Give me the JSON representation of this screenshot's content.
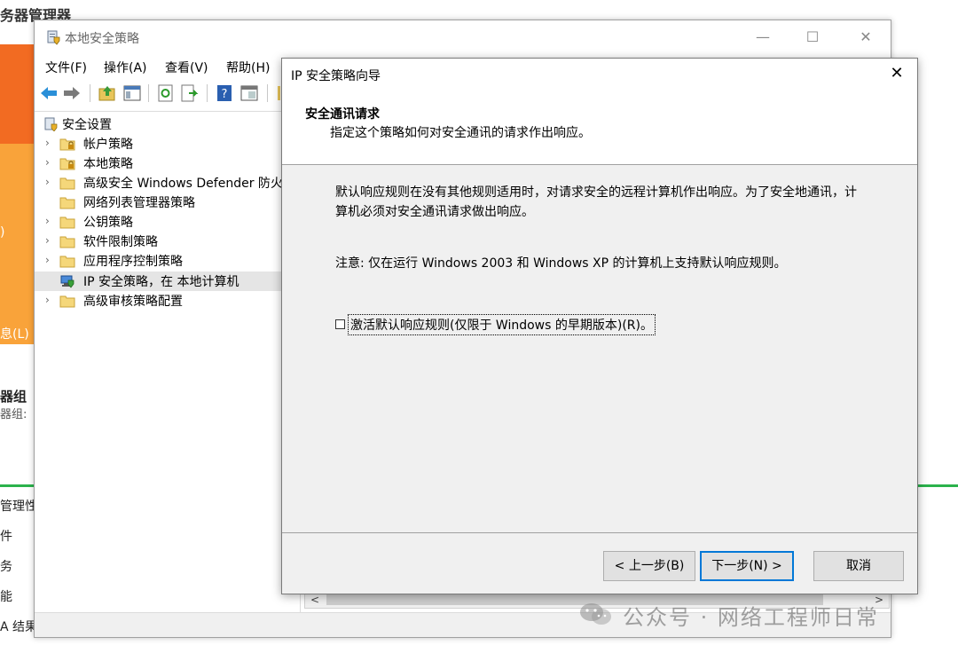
{
  "background": {
    "title_partial": "务器管理器",
    "left_fragments": [
      {
        "text": ")"
      },
      {
        "text": "息(L)"
      },
      {
        "text": "器组"
      },
      {
        "text": "器组:"
      },
      {
        "text": "管理性"
      },
      {
        "text": "件"
      },
      {
        "text": "务"
      },
      {
        "text": "能"
      },
      {
        "text": "A 结果"
      }
    ],
    "accent_color": "#f26b22",
    "accent_color_light": "#f9a33a",
    "green_line_color": "#2bb24c"
  },
  "lsp_window": {
    "title": "本地安全策略",
    "controls": {
      "minimize": "—",
      "maximize": "☐",
      "close": "✕"
    },
    "menu": [
      {
        "label": "文件(F)"
      },
      {
        "label": "操作(A)"
      },
      {
        "label": "查看(V)"
      },
      {
        "label": "帮助(H)"
      }
    ],
    "tree": [
      {
        "label": "安全设置",
        "icon": "security-settings-icon",
        "expander": ""
      },
      {
        "label": "帐户策略",
        "icon": "folder-lock-icon",
        "expander": "›"
      },
      {
        "label": "本地策略",
        "icon": "folder-lock-icon",
        "expander": "›"
      },
      {
        "label": "高级安全 Windows Defender 防火墙",
        "icon": "folder-icon",
        "expander": "›"
      },
      {
        "label": "网络列表管理器策略",
        "icon": "folder-icon",
        "expander": ""
      },
      {
        "label": "公钥策略",
        "icon": "folder-icon",
        "expander": "›"
      },
      {
        "label": "软件限制策略",
        "icon": "folder-icon",
        "expander": "›"
      },
      {
        "label": "应用程序控制策略",
        "icon": "folder-icon",
        "expander": "›"
      },
      {
        "label": "IP 安全策略，在 本地计算机",
        "icon": "ip-security-icon",
        "expander": "",
        "selected": true
      },
      {
        "label": "高级审核策略配置",
        "icon": "folder-icon",
        "expander": "›"
      }
    ],
    "scroll": {
      "left": "<",
      "right": ">"
    }
  },
  "wizard": {
    "title": "IP 安全策略向导",
    "close": "✕",
    "heading": "安全通讯请求",
    "subheading": "指定这个策略如何对安全通讯的请求作出响应。",
    "description": "默认响应规则在没有其他规则适用时，对请求安全的远程计算机作出响应。为了安全地通讯，计算机必须对安全通讯请求做出响应。",
    "note": "注意: 仅在运行 Windows 2003 和 Windows XP 的计算机上支持默认响应规则。",
    "checkbox_label": "激活默认响应规则(仅限于 Windows 的早期版本)(R)。",
    "checkbox_checked": false,
    "buttons": {
      "back": "< 上一步(B)",
      "next": "下一步(N) >",
      "cancel": "取消"
    },
    "accent_color": "#0078d7"
  },
  "watermark": {
    "text": "公众号 · 网络工程师日常"
  }
}
